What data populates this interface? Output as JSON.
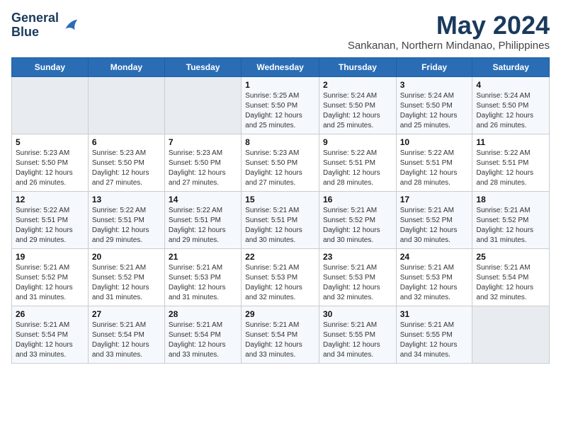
{
  "logo": {
    "line1": "General",
    "line2": "Blue"
  },
  "title": "May 2024",
  "subtitle": "Sankanan, Northern Mindanao, Philippines",
  "days_header": [
    "Sunday",
    "Monday",
    "Tuesday",
    "Wednesday",
    "Thursday",
    "Friday",
    "Saturday"
  ],
  "weeks": [
    [
      {
        "day": "",
        "info": ""
      },
      {
        "day": "",
        "info": ""
      },
      {
        "day": "",
        "info": ""
      },
      {
        "day": "1",
        "info": "Sunrise: 5:25 AM\nSunset: 5:50 PM\nDaylight: 12 hours\nand 25 minutes."
      },
      {
        "day": "2",
        "info": "Sunrise: 5:24 AM\nSunset: 5:50 PM\nDaylight: 12 hours\nand 25 minutes."
      },
      {
        "day": "3",
        "info": "Sunrise: 5:24 AM\nSunset: 5:50 PM\nDaylight: 12 hours\nand 25 minutes."
      },
      {
        "day": "4",
        "info": "Sunrise: 5:24 AM\nSunset: 5:50 PM\nDaylight: 12 hours\nand 26 minutes."
      }
    ],
    [
      {
        "day": "5",
        "info": "Sunrise: 5:23 AM\nSunset: 5:50 PM\nDaylight: 12 hours\nand 26 minutes."
      },
      {
        "day": "6",
        "info": "Sunrise: 5:23 AM\nSunset: 5:50 PM\nDaylight: 12 hours\nand 27 minutes."
      },
      {
        "day": "7",
        "info": "Sunrise: 5:23 AM\nSunset: 5:50 PM\nDaylight: 12 hours\nand 27 minutes."
      },
      {
        "day": "8",
        "info": "Sunrise: 5:23 AM\nSunset: 5:50 PM\nDaylight: 12 hours\nand 27 minutes."
      },
      {
        "day": "9",
        "info": "Sunrise: 5:22 AM\nSunset: 5:51 PM\nDaylight: 12 hours\nand 28 minutes."
      },
      {
        "day": "10",
        "info": "Sunrise: 5:22 AM\nSunset: 5:51 PM\nDaylight: 12 hours\nand 28 minutes."
      },
      {
        "day": "11",
        "info": "Sunrise: 5:22 AM\nSunset: 5:51 PM\nDaylight: 12 hours\nand 28 minutes."
      }
    ],
    [
      {
        "day": "12",
        "info": "Sunrise: 5:22 AM\nSunset: 5:51 PM\nDaylight: 12 hours\nand 29 minutes."
      },
      {
        "day": "13",
        "info": "Sunrise: 5:22 AM\nSunset: 5:51 PM\nDaylight: 12 hours\nand 29 minutes."
      },
      {
        "day": "14",
        "info": "Sunrise: 5:22 AM\nSunset: 5:51 PM\nDaylight: 12 hours\nand 29 minutes."
      },
      {
        "day": "15",
        "info": "Sunrise: 5:21 AM\nSunset: 5:51 PM\nDaylight: 12 hours\nand 30 minutes."
      },
      {
        "day": "16",
        "info": "Sunrise: 5:21 AM\nSunset: 5:52 PM\nDaylight: 12 hours\nand 30 minutes."
      },
      {
        "day": "17",
        "info": "Sunrise: 5:21 AM\nSunset: 5:52 PM\nDaylight: 12 hours\nand 30 minutes."
      },
      {
        "day": "18",
        "info": "Sunrise: 5:21 AM\nSunset: 5:52 PM\nDaylight: 12 hours\nand 31 minutes."
      }
    ],
    [
      {
        "day": "19",
        "info": "Sunrise: 5:21 AM\nSunset: 5:52 PM\nDaylight: 12 hours\nand 31 minutes."
      },
      {
        "day": "20",
        "info": "Sunrise: 5:21 AM\nSunset: 5:52 PM\nDaylight: 12 hours\nand 31 minutes."
      },
      {
        "day": "21",
        "info": "Sunrise: 5:21 AM\nSunset: 5:53 PM\nDaylight: 12 hours\nand 31 minutes."
      },
      {
        "day": "22",
        "info": "Sunrise: 5:21 AM\nSunset: 5:53 PM\nDaylight: 12 hours\nand 32 minutes."
      },
      {
        "day": "23",
        "info": "Sunrise: 5:21 AM\nSunset: 5:53 PM\nDaylight: 12 hours\nand 32 minutes."
      },
      {
        "day": "24",
        "info": "Sunrise: 5:21 AM\nSunset: 5:53 PM\nDaylight: 12 hours\nand 32 minutes."
      },
      {
        "day": "25",
        "info": "Sunrise: 5:21 AM\nSunset: 5:54 PM\nDaylight: 12 hours\nand 32 minutes."
      }
    ],
    [
      {
        "day": "26",
        "info": "Sunrise: 5:21 AM\nSunset: 5:54 PM\nDaylight: 12 hours\nand 33 minutes."
      },
      {
        "day": "27",
        "info": "Sunrise: 5:21 AM\nSunset: 5:54 PM\nDaylight: 12 hours\nand 33 minutes."
      },
      {
        "day": "28",
        "info": "Sunrise: 5:21 AM\nSunset: 5:54 PM\nDaylight: 12 hours\nand 33 minutes."
      },
      {
        "day": "29",
        "info": "Sunrise: 5:21 AM\nSunset: 5:54 PM\nDaylight: 12 hours\nand 33 minutes."
      },
      {
        "day": "30",
        "info": "Sunrise: 5:21 AM\nSunset: 5:55 PM\nDaylight: 12 hours\nand 34 minutes."
      },
      {
        "day": "31",
        "info": "Sunrise: 5:21 AM\nSunset: 5:55 PM\nDaylight: 12 hours\nand 34 minutes."
      },
      {
        "day": "",
        "info": ""
      }
    ]
  ]
}
